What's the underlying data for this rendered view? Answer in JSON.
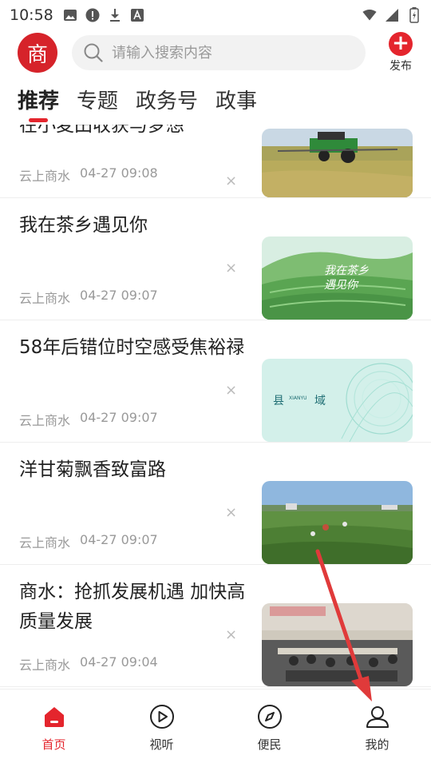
{
  "status_bar": {
    "time": "10:58"
  },
  "top_bar": {
    "logo_text": "商",
    "search_placeholder": "请输入搜索内容",
    "publish_label": "发布"
  },
  "tabs": [
    {
      "label": "推荐",
      "active": true
    },
    {
      "label": "专题",
      "active": false
    },
    {
      "label": "政务号",
      "active": false
    },
    {
      "label": "政事",
      "active": false
    }
  ],
  "news": [
    {
      "title": "在小麦田收获与梦想",
      "source": "云上商水",
      "time": "04-27 09:08"
    },
    {
      "title": "我在茶乡遇见你",
      "source": "云上商水",
      "time": "04-27 09:07",
      "thumb_text": "我在茶乡 遇见你"
    },
    {
      "title": "58年后错位时空感受焦裕禄",
      "source": "云上商水",
      "time": "04-27 09:07",
      "thumb_text_left": "县",
      "thumb_text_mid": "XIANYU",
      "thumb_text_right": "域"
    },
    {
      "title": "洋甘菊飘香致富路",
      "source": "云上商水",
      "time": "04-27 09:07"
    },
    {
      "title": "商水：抢抓发展机遇 加快高质量发展",
      "source": "云上商水",
      "time": "04-27 09:04"
    }
  ],
  "bottom_nav": [
    {
      "label": "首页",
      "icon": "home-icon",
      "active": true
    },
    {
      "label": "视听",
      "icon": "play-icon",
      "active": false
    },
    {
      "label": "便民",
      "icon": "compass-icon",
      "active": false
    },
    {
      "label": "我的",
      "icon": "user-icon",
      "active": false
    }
  ],
  "colors": {
    "accent": "#e4252d",
    "logo": "#d6232a"
  }
}
